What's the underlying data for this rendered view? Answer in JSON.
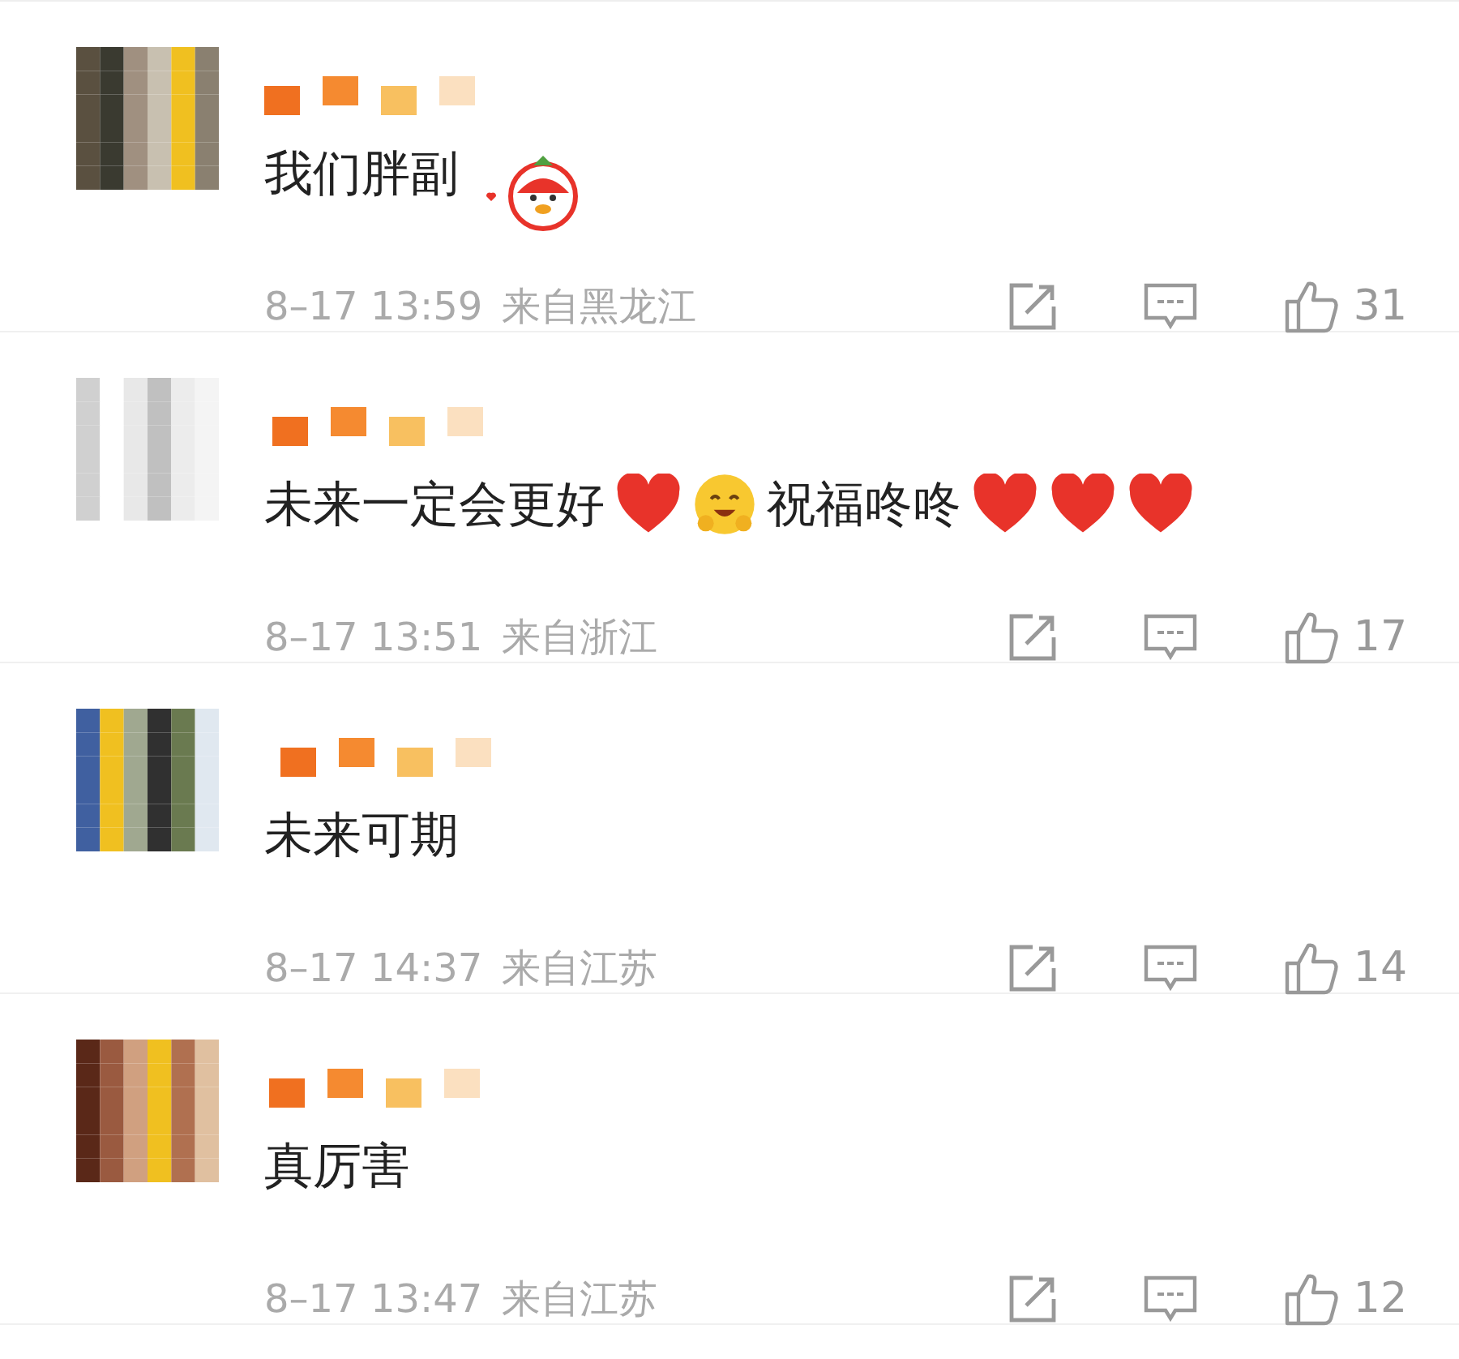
{
  "comments": [
    {
      "content": [
        {
          "kind": "text",
          "text": "我们胖副"
        },
        {
          "kind": "sticker"
        }
      ],
      "time": "8–17 13:59",
      "location": "来自黑龙江",
      "likes": "31"
    },
    {
      "content": [
        {
          "kind": "text",
          "text": "未来一定会更好"
        },
        {
          "kind": "heart"
        },
        {
          "kind": "smile"
        },
        {
          "kind": "text",
          "text": "祝福咚咚"
        },
        {
          "kind": "heart"
        },
        {
          "kind": "heart"
        },
        {
          "kind": "heart"
        }
      ],
      "time": "8–17 13:51",
      "location": "来自浙江",
      "likes": "17"
    },
    {
      "content": [
        {
          "kind": "text",
          "text": "未来可期"
        }
      ],
      "time": "8–17 14:37",
      "location": "来自江苏",
      "likes": "14"
    },
    {
      "content": [
        {
          "kind": "text",
          "text": "真厉害"
        }
      ],
      "time": "8–17 13:47",
      "location": "来自江苏",
      "likes": "12"
    }
  ]
}
